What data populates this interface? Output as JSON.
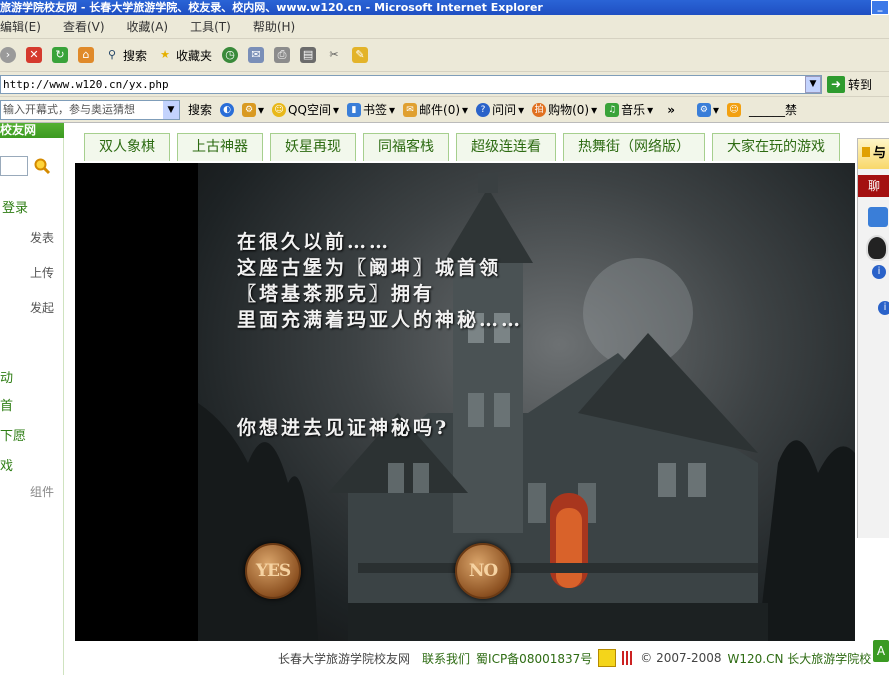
{
  "window": {
    "title": "旅游学院校友网 - 长春大学旅游学院、校友录、校内网、www.w120.cn - Microsoft Internet Explorer",
    "minimize_label": "_"
  },
  "menu": [
    "编辑(E)",
    "查看(V)",
    "收藏(A)",
    "工具(T)",
    "帮助(H)"
  ],
  "toolbar": {
    "search_label": "搜索",
    "favorites_label": "收藏夹"
  },
  "address": {
    "url": "http://www.w120.cn/yx.php",
    "go_label": "转到"
  },
  "linksbar": {
    "search_placeholder": "输入开幕式，参与奥运猜想",
    "search_label": "搜索",
    "items": [
      "QQ空间",
      "书签",
      "邮件(0)",
      "问问",
      "购物(0)",
      "音乐"
    ],
    "more_label": "»",
    "right_text": "______禁"
  },
  "sidebar": {
    "title": "校友网",
    "login_label": "登录",
    "actions": [
      "发表",
      "上传",
      "发起"
    ],
    "links": [
      "动",
      "首",
      "下愿",
      "戏"
    ],
    "footer_label": "组件"
  },
  "tabs": [
    "双人象棋",
    "上古神器",
    "妖星再现",
    "同福客栈",
    "超级连连看",
    "热舞街（网络版）",
    "大家在玩的游戏"
  ],
  "game": {
    "story_lines": [
      "在很久以前……",
      "这座古堡为〖阚坤〗城首领",
      "〖塔基茶那克〗拥有",
      "里面充满着玛亚人的神秘……"
    ],
    "question": "你想进去见证神秘吗?",
    "yes_label": "YES",
    "no_label": "NO"
  },
  "footer": {
    "site_name": "长春大学旅游学院校友网",
    "contact_label": "联系我们",
    "icp": "蜀ICP备08001837号",
    "copyright": "© 2007-2008",
    "brand": "W120.CN 长大旅游学院校"
  },
  "right_panel": {
    "head": "与",
    "red_label": "聊"
  },
  "colors": {
    "title_bar": "#1f4fc2",
    "accent_green": "#2d6b12",
    "tab_border": "#a6cf8e"
  }
}
